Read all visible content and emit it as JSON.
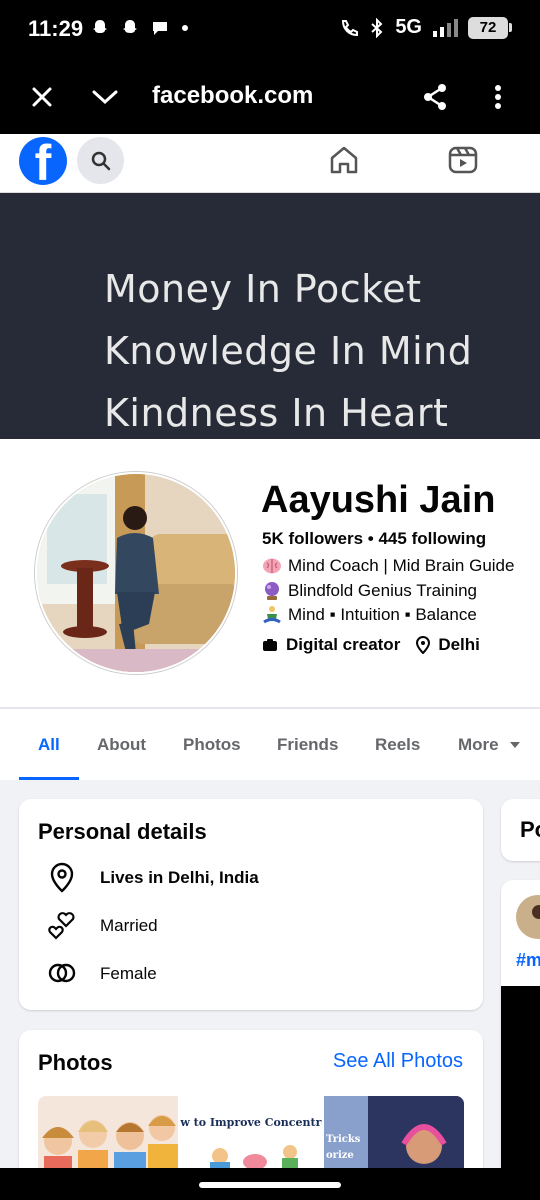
{
  "status_bar": {
    "time": "11:29",
    "network": "5G",
    "battery": "72"
  },
  "browser": {
    "url": "facebook.com"
  },
  "cover": {
    "lines": [
      "Money In Pocket",
      "Knowledge In Mind",
      "Kindness In Heart"
    ]
  },
  "profile": {
    "name": "Aayushi Jain",
    "stats": "5K followers • 445 following",
    "bio": [
      {
        "emoji": "brain-emoji",
        "text": "Mind Coach | Mid Brain Guide"
      },
      {
        "emoji": "crystal-ball-emoji",
        "text": "Blindfold Genius Training"
      },
      {
        "emoji": "meditating-person-emoji",
        "text": "Mind  ▪ Intuition  ▪ Balance"
      }
    ],
    "category": "Digital creator",
    "location": "Delhi"
  },
  "tabs": [
    "All",
    "About",
    "Photos",
    "Friends",
    "Reels",
    "More"
  ],
  "personal_details": {
    "title": "Personal details",
    "lives_in": "Lives in Delhi, India",
    "relationship": "Married",
    "gender": "Female"
  },
  "photos": {
    "title": "Photos",
    "see_all": "See All Photos",
    "items": [
      {
        "caption": ""
      },
      {
        "caption": "w to Improve Concentration in K"
      },
      {
        "caption": "Tricks\norize"
      },
      {
        "caption": ""
      }
    ]
  },
  "side_card": {
    "title_fragment": "Po",
    "hashtag_fragment": "#m"
  },
  "colors": {
    "fb_blue": "#0866ff",
    "cover_bg": "#262b37",
    "page_bg": "#f0f2f5"
  }
}
